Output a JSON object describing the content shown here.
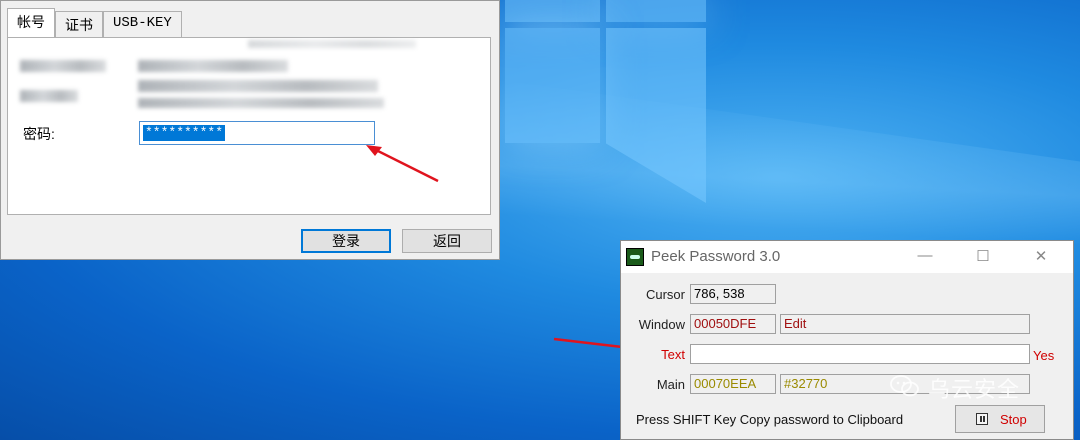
{
  "login_dialog": {
    "tabs": [
      "帐号",
      "证书",
      "USB-KEY"
    ],
    "password_label": "密码:",
    "password_value": "**********",
    "login_button": "登录",
    "back_button": "返回"
  },
  "peek_window": {
    "title": "Peek Password 3.0",
    "minimize": "—",
    "maximize": "☐",
    "close": "✕",
    "cursor_label": "Cursor",
    "cursor_value": "786, 538",
    "window_label": "Window",
    "window_handle": "00050DFE",
    "window_class": "Edit",
    "text_label": "Text",
    "text_value": "",
    "text_status": "Yes",
    "main_label": "Main",
    "main_handle": "00070EEA",
    "main_class": "#32770",
    "hint": "Press SHIFT Key Copy password to Clipboard",
    "stop_button": "Stop"
  },
  "watermark": {
    "text": "乌云安全"
  },
  "colors": {
    "arrow": "#e0141e",
    "selection": "#0078d7",
    "accent_red": "#d00000"
  }
}
